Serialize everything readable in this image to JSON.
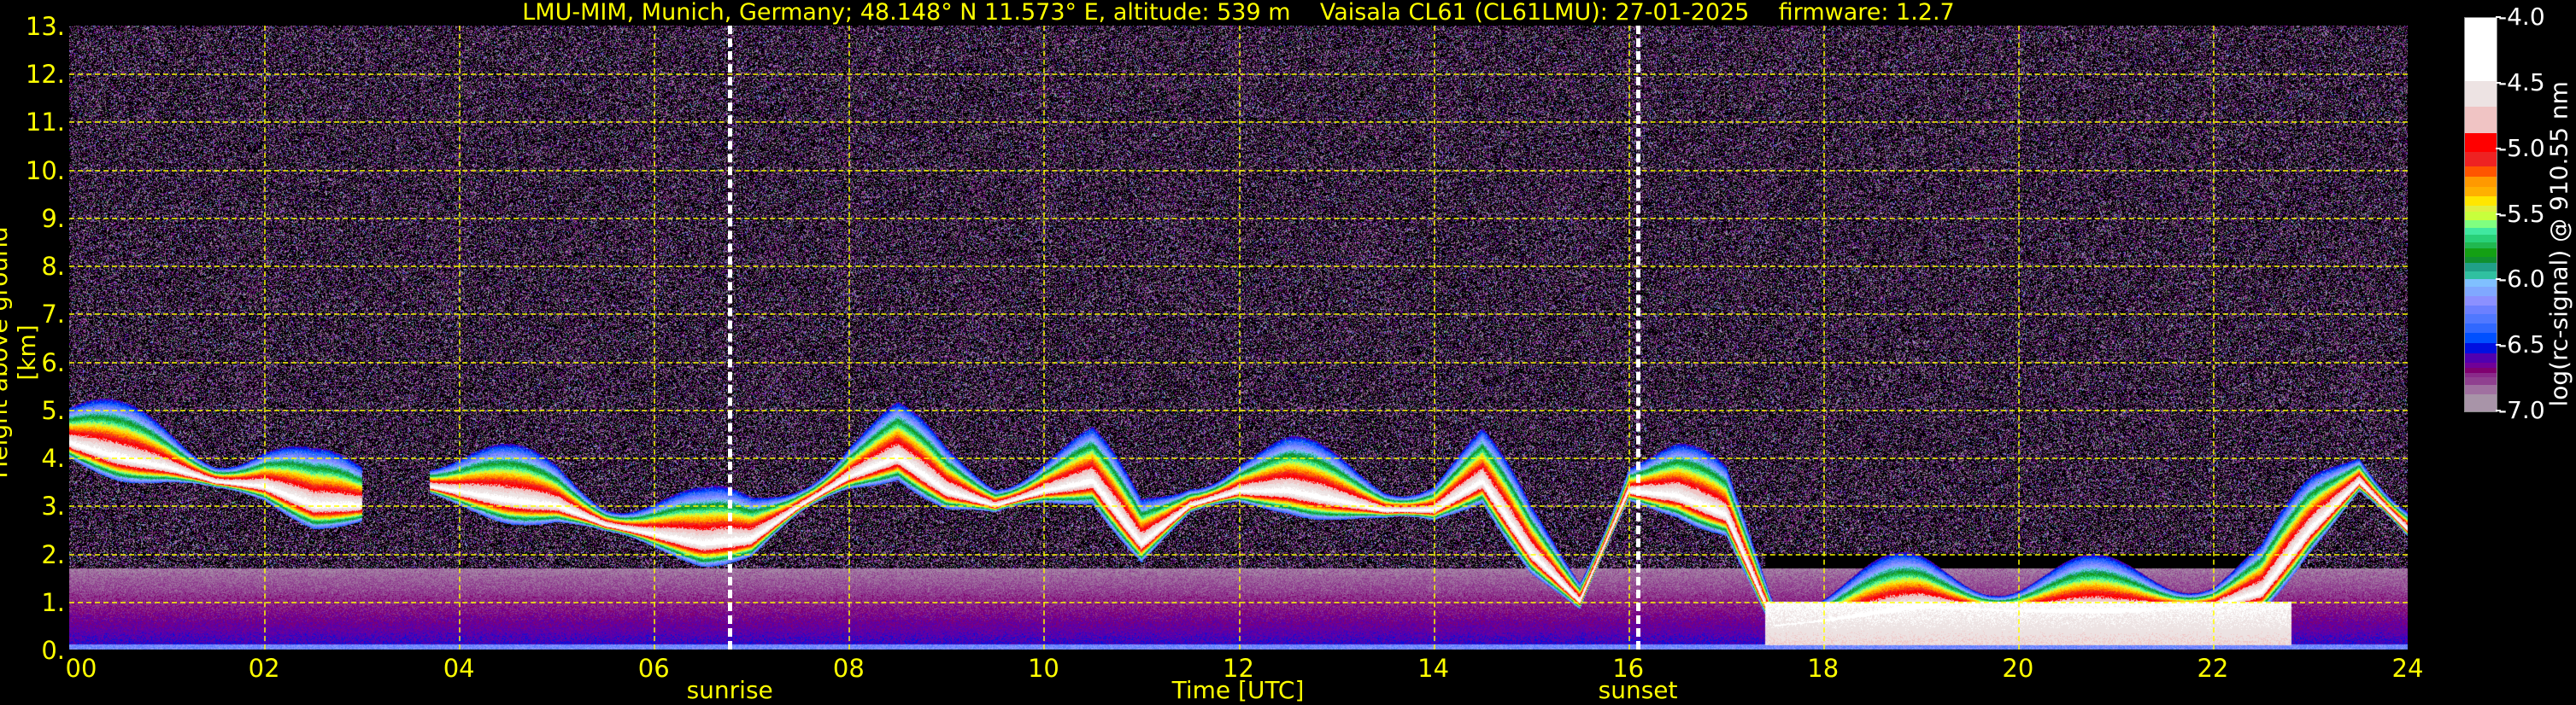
{
  "title": "LMU-MIM, Munich, Germany; 48.148° N 11.573° E, altitude: 539 m    Vaisala CL61 (CL61LMU): 27-01-2025    firmware: 1.2.7",
  "chart_data": {
    "type": "heatmap",
    "title": "LMU-MIM, Munich, Germany; 48.148° N 11.573° E, altitude: 539 m    Vaisala CL61 (CL61LMU): 27-01-2025    firmware: 1.2.7",
    "xlabel": "Time [UTC]",
    "ylabel": "Height above ground [km]",
    "xlim": [
      0,
      24
    ],
    "ylim": [
      0,
      13
    ],
    "grid": true,
    "x_ticks": [
      0,
      2,
      4,
      6,
      8,
      10,
      12,
      14,
      16,
      18,
      20,
      22,
      24
    ],
    "x_tick_labels": [
      "00",
      "02",
      "04",
      "06",
      "08",
      "10",
      "12",
      "14",
      "16",
      "18",
      "20",
      "22",
      "24"
    ],
    "y_ticks": [
      0,
      1,
      2,
      3,
      4,
      5,
      6,
      7,
      8,
      9,
      10,
      11,
      12,
      13
    ],
    "y_tick_labels": [
      "0.",
      "1.",
      "2.",
      "3.",
      "4.",
      "5.",
      "6.",
      "7.",
      "8.",
      "9.",
      "10.",
      "11.",
      "12.",
      "13."
    ],
    "markers": [
      {
        "label": "sunrise",
        "time": 6.78
      },
      {
        "label": "sunset",
        "time": 16.1
      }
    ],
    "colorbar": {
      "label": "log(rc-signal) @ 910.55 nm",
      "range": [
        -7.0,
        -4.0
      ],
      "ticks": [
        -4.0,
        -4.5,
        -5.0,
        -5.5,
        -6.0,
        -6.5,
        -7.0
      ],
      "tick_labels": [
        "-4.0",
        "-4.5",
        "-5.0",
        "-5.5",
        "-6.0",
        "-6.5",
        "-7.0"
      ],
      "levels": [
        {
          "from": -4.0,
          "to": -4.48,
          "color": "#ffffff"
        },
        {
          "from": -4.48,
          "to": -4.68,
          "color": "#ede3e3"
        },
        {
          "from": -4.68,
          "to": -4.88,
          "color": "#f0c4c4"
        },
        {
          "from": -4.88,
          "to": -5.02,
          "color": "#ff0000"
        },
        {
          "from": -5.02,
          "to": -5.13,
          "color": "#ee2222"
        },
        {
          "from": -5.13,
          "to": -5.21,
          "color": "#ff5500"
        },
        {
          "from": -5.21,
          "to": -5.29,
          "color": "#ff9900"
        },
        {
          "from": -5.29,
          "to": -5.36,
          "color": "#ffb000"
        },
        {
          "from": -5.36,
          "to": -5.43,
          "color": "#ffe600"
        },
        {
          "from": -5.43,
          "to": -5.48,
          "color": "#e0f040"
        },
        {
          "from": -5.48,
          "to": -5.54,
          "color": "#c8ff3c"
        },
        {
          "from": -5.54,
          "to": -5.6,
          "color": "#80ff80"
        },
        {
          "from": -5.6,
          "to": -5.65,
          "color": "#40e8a0"
        },
        {
          "from": -5.65,
          "to": -5.71,
          "color": "#28d078"
        },
        {
          "from": -5.71,
          "to": -5.76,
          "color": "#20b850"
        },
        {
          "from": -5.76,
          "to": -5.82,
          "color": "#14a014"
        },
        {
          "from": -5.82,
          "to": -5.87,
          "color": "#109030"
        },
        {
          "from": -5.87,
          "to": -5.93,
          "color": "#20a088"
        },
        {
          "from": -5.93,
          "to": -5.99,
          "color": "#30c0a0"
        },
        {
          "from": -5.99,
          "to": -6.05,
          "color": "#80c0ff"
        },
        {
          "from": -6.05,
          "to": -6.12,
          "color": "#80a8ff"
        },
        {
          "from": -6.12,
          "to": -6.19,
          "color": "#8c90ff"
        },
        {
          "from": -6.19,
          "to": -6.26,
          "color": "#6c80ff"
        },
        {
          "from": -6.26,
          "to": -6.33,
          "color": "#5078ff"
        },
        {
          "from": -6.33,
          "to": -6.4,
          "color": "#3068ff"
        },
        {
          "from": -6.4,
          "to": -6.48,
          "color": "#0050ff"
        },
        {
          "from": -6.48,
          "to": -6.56,
          "color": "#0010e0"
        },
        {
          "from": -6.56,
          "to": -6.63,
          "color": "#5000b0"
        },
        {
          "from": -6.63,
          "to": -6.67,
          "color": "#700098"
        },
        {
          "from": -6.67,
          "to": -6.71,
          "color": "#800070"
        },
        {
          "from": -6.71,
          "to": -6.74,
          "color": "#8a2a8a"
        },
        {
          "from": -6.74,
          "to": -6.8,
          "color": "#904090"
        },
        {
          "from": -6.8,
          "to": -6.87,
          "color": "#a070a0"
        },
        {
          "from": -6.87,
          "to": -7.0,
          "color": "#a894a8"
        }
      ]
    },
    "cloud_layer": {
      "time_h": [
        0,
        0.5,
        1,
        1.5,
        2,
        2.5,
        3,
        3.2,
        3.7,
        4.5,
        5,
        5.5,
        6,
        6.5,
        7,
        7.5,
        8,
        8.5,
        9,
        9.5,
        10,
        10.5,
        11,
        11.5,
        12,
        12.5,
        13,
        13.5,
        14,
        14.5,
        15,
        15.5,
        16,
        16.5,
        17,
        17.5,
        18,
        19,
        20,
        21,
        22,
        22.5,
        23,
        23.5,
        24
      ],
      "height_km": [
        4.3,
        4.0,
        3.8,
        3.5,
        3.4,
        3.0,
        3.0,
        0,
        3.4,
        3.1,
        3.0,
        2.6,
        2.4,
        2.2,
        2.3,
        3.0,
        3.6,
        4.0,
        3.3,
        3.0,
        3.3,
        3.5,
        2.2,
        3.0,
        3.3,
        3.3,
        3.1,
        2.9,
        2.9,
        3.5,
        2.0,
        1.0,
        3.3,
        3.2,
        2.8,
        0.5,
        0.6,
        0.9,
        0.8,
        0.8,
        0.9,
        1.2,
        2.5,
        3.5,
        2.5
      ],
      "peak_log_signal": -4.3
    },
    "boundary_layer_top_km": 1.7,
    "noise_level_log_signal": -6.6
  }
}
